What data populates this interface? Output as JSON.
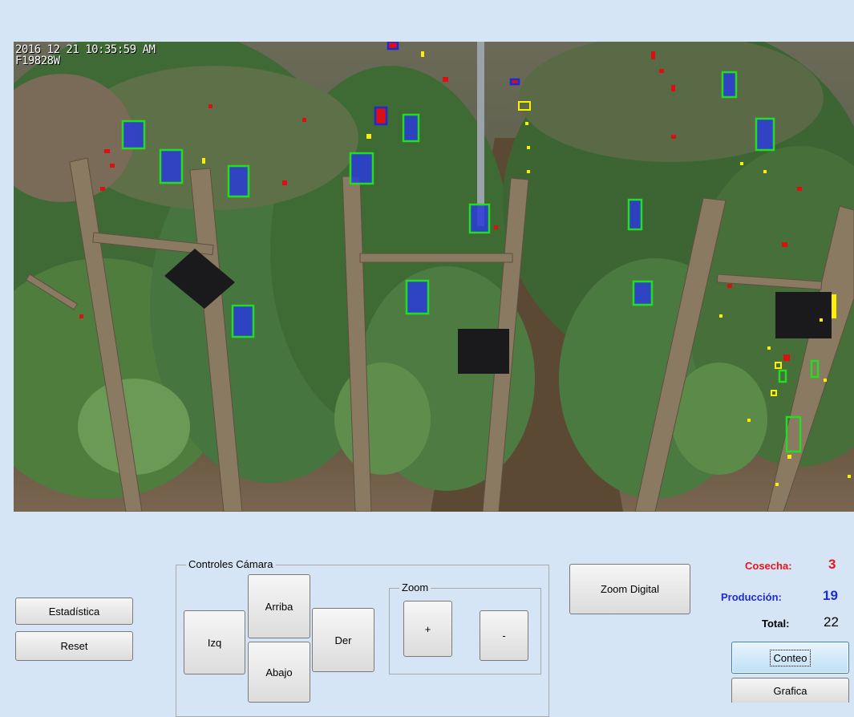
{
  "camera": {
    "timestamp": "2016 12 21 10:35:59 AM",
    "camera_id": "F19828W"
  },
  "left_buttons": {
    "statistics": "Estadística",
    "reset": "Reset"
  },
  "camera_controls": {
    "title": "Controles Cámara",
    "up": "Arriba",
    "down": "Abajo",
    "left": "Izq",
    "right": "Der",
    "zoom": {
      "title": "Zoom",
      "in": "+",
      "out": "-"
    }
  },
  "zoom_digital": "Zoom Digital",
  "counters": {
    "harvest_label": "Cosecha:",
    "harvest_value": "3",
    "production_label": "Producción:",
    "production_value": "19",
    "total_label": "Total:",
    "total_value": "22"
  },
  "action_buttons": {
    "count": "Conteo",
    "chart": "Grafica"
  },
  "colors": {
    "background": "#d6e5f5",
    "harvest": "#e8141c",
    "production": "#1c2bd6",
    "detection_box": "#22dd22",
    "detection_fill": "#2a3bd8",
    "yellow_marker": "#ffee00",
    "red_marker": "#dd1010"
  }
}
